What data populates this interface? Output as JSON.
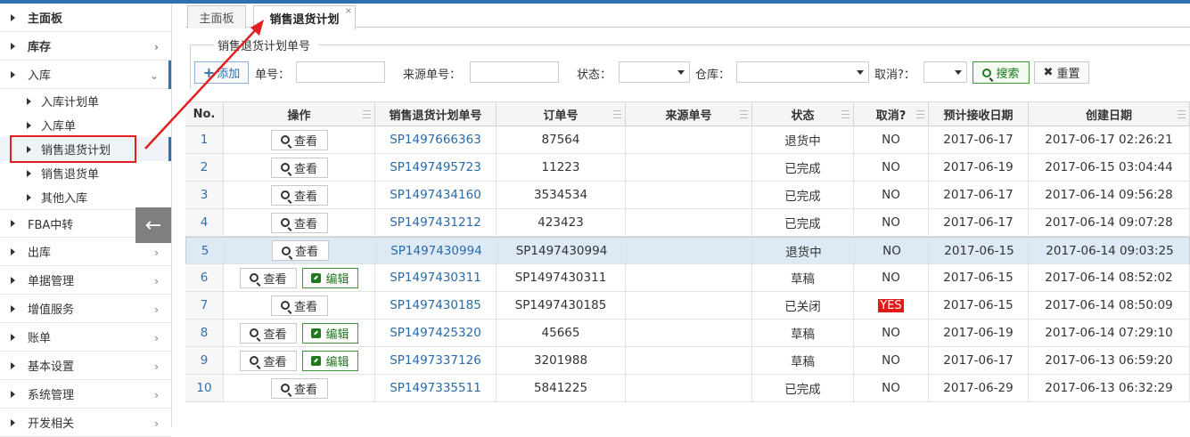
{
  "sidebar": {
    "items": [
      {
        "label": "主面板"
      },
      {
        "label": "库存"
      },
      {
        "label": "入库"
      },
      {
        "label": "FBA中转"
      },
      {
        "label": "出库"
      },
      {
        "label": "单据管理"
      },
      {
        "label": "增值服务"
      },
      {
        "label": "账单"
      },
      {
        "label": "基本设置"
      },
      {
        "label": "系统管理"
      },
      {
        "label": "开发相关"
      }
    ],
    "sub_items": [
      {
        "label": "入库计划单"
      },
      {
        "label": "入库单"
      },
      {
        "label": "销售退货计划"
      },
      {
        "label": "销售退货单"
      },
      {
        "label": "其他入库"
      }
    ],
    "collapse_icon": "←"
  },
  "tabs": [
    {
      "label": "主面板"
    },
    {
      "label": "销售退货计划",
      "close": "×"
    }
  ],
  "filter": {
    "legend": "销售退货计划单号",
    "add_label": "添加",
    "order_no_label": "单号：",
    "source_no_label": "来源单号：",
    "status_label": "状态：",
    "warehouse_label": "仓库：",
    "cancel_label": "取消?：",
    "search_label": "搜索",
    "reset_label": "重置"
  },
  "table": {
    "columns": [
      "No.",
      "操作",
      "销售退货计划单号",
      "订单号",
      "来源单号",
      "状态",
      "取消?",
      "预计接收日期",
      "创建日期"
    ],
    "view_label": "查看",
    "edit_label": "编辑",
    "rows": [
      {
        "no": "1",
        "plan_no": "SP1497666363",
        "order_no": "87564",
        "source_no": "",
        "status": "退货中",
        "cancel": "NO",
        "eta": "2017-06-17",
        "created": "2017-06-17 02:26:21",
        "editable": false
      },
      {
        "no": "2",
        "plan_no": "SP1497495723",
        "order_no": "11223",
        "source_no": "",
        "status": "已完成",
        "cancel": "NO",
        "eta": "2017-06-19",
        "created": "2017-06-15 03:04:44",
        "editable": false
      },
      {
        "no": "3",
        "plan_no": "SP1497434160",
        "order_no": "3534534",
        "source_no": "",
        "status": "已完成",
        "cancel": "NO",
        "eta": "2017-06-17",
        "created": "2017-06-14 09:56:28",
        "editable": false
      },
      {
        "no": "4",
        "plan_no": "SP1497431212",
        "order_no": "423423",
        "source_no": "",
        "status": "已完成",
        "cancel": "NO",
        "eta": "2017-06-17",
        "created": "2017-06-14 09:07:28",
        "editable": false
      },
      {
        "no": "5",
        "plan_no": "SP1497430994",
        "order_no": "SP1497430994",
        "source_no": "",
        "status": "退货中",
        "cancel": "NO",
        "eta": "2017-06-15",
        "created": "2017-06-14 09:03:25",
        "editable": false,
        "selected": true
      },
      {
        "no": "6",
        "plan_no": "SP1497430311",
        "order_no": "SP1497430311",
        "source_no": "",
        "status": "草稿",
        "cancel": "NO",
        "eta": "2017-06-15",
        "created": "2017-06-14 08:52:02",
        "editable": true
      },
      {
        "no": "7",
        "plan_no": "SP1497430185",
        "order_no": "SP1497430185",
        "source_no": "",
        "status": "已关闭",
        "cancel": "YES",
        "eta": "2017-06-15",
        "created": "2017-06-14 08:50:09",
        "editable": false
      },
      {
        "no": "8",
        "plan_no": "SP1497425320",
        "order_no": "45665",
        "source_no": "",
        "status": "草稿",
        "cancel": "NO",
        "eta": "2017-06-19",
        "created": "2017-06-14 07:29:10",
        "editable": true
      },
      {
        "no": "9",
        "plan_no": "SP1497337126",
        "order_no": "3201988",
        "source_no": "",
        "status": "草稿",
        "cancel": "NO",
        "eta": "2017-06-17",
        "created": "2017-06-13 06:59:20",
        "editable": true
      },
      {
        "no": "10",
        "plan_no": "SP1497335511",
        "order_no": "5841225",
        "source_no": "",
        "status": "已完成",
        "cancel": "NO",
        "eta": "2017-06-29",
        "created": "2017-06-13 06:32:29",
        "editable": false
      }
    ]
  },
  "colors": {
    "accent": "#2f6fb0",
    "highlight": "#e02020",
    "cancel_yes": "#e41818"
  }
}
